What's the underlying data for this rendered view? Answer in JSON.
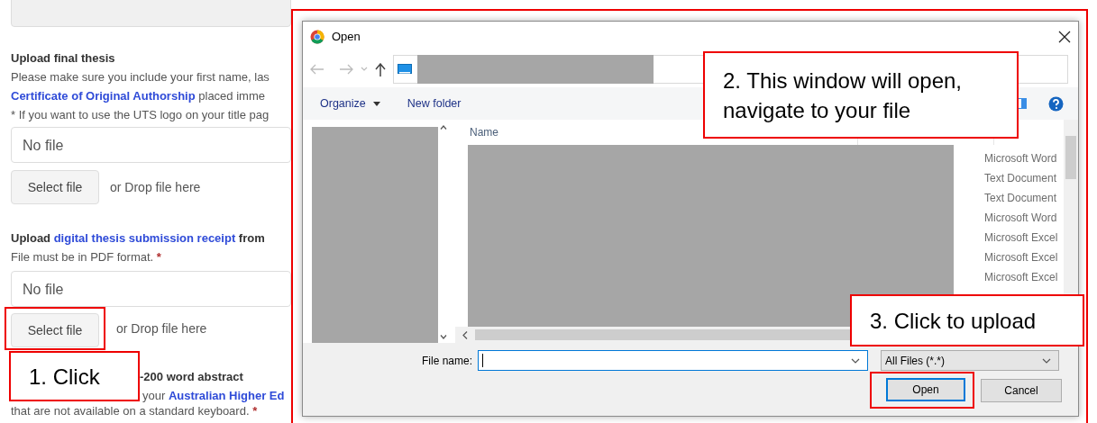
{
  "page": {
    "sections": [
      {
        "kind": "upload",
        "heading": [
          {
            "kind": "bold",
            "text": "Upload final thesis"
          }
        ],
        "lines": [
          [
            {
              "kind": "plain",
              "text": "Please make sure you include your first name, las"
            }
          ],
          [
            {
              "kind": "link",
              "text": "Certificate of Original Authorship"
            },
            {
              "kind": "plain",
              "text": " placed imme"
            }
          ],
          [
            {
              "kind": "plain",
              "text": "* If you want to use the UTS logo on your title pag"
            }
          ]
        ],
        "field": {
          "placeholder": "No file"
        },
        "button": {
          "label": "Select file",
          "highlighted": false
        },
        "drop_hint": "or Drop file here"
      },
      {
        "kind": "upload",
        "heading": [
          {
            "kind": "bold",
            "text": "Upload "
          },
          {
            "kind": "link",
            "text": "digital thesis submission receipt"
          },
          {
            "kind": "bold",
            "text": " from"
          }
        ],
        "lines": [
          [
            {
              "kind": "plain",
              "text": "File must be in PDF format. "
            },
            {
              "kind": "required",
              "text": "*"
            }
          ]
        ],
        "field": {
          "placeholder": "No file"
        },
        "button": {
          "label": "Select file",
          "highlighted": true
        },
        "drop_hint": "or Drop file here"
      },
      {
        "kind": "covered",
        "heading": [
          {
            "kind": "bold",
            "text": "-200 word abstract"
          }
        ],
        "lines": [
          [
            {
              "kind": "plain",
              "text": "your "
            },
            {
              "kind": "link",
              "text": "Australian Higher Ed"
            }
          ],
          [
            {
              "kind": "plain",
              "text": "that are not available on a standard keyboard. "
            },
            {
              "kind": "required",
              "text": "*"
            }
          ]
        ]
      }
    ]
  },
  "dialog": {
    "title": "Open",
    "highlighted": true,
    "toolbar": [
      {
        "label": "Organize",
        "kind": "menu"
      },
      {
        "label": "New folder",
        "kind": "action"
      }
    ],
    "column_header": "Name",
    "file_types": [
      "Microsoft Word",
      "Text Document",
      "Text Document",
      "Microsoft Word",
      "Microsoft Excel",
      "Microsoft Excel",
      "Microsoft Excel"
    ],
    "file_name": {
      "label": "File name:",
      "focused": true
    },
    "filter": "All Files (*.*)",
    "buttons": [
      {
        "label": "Open",
        "default": true,
        "highlighted": true
      },
      {
        "label": "Cancel",
        "default": false,
        "highlighted": false
      }
    ]
  },
  "annotations": [
    {
      "text": "1. Click"
    },
    {
      "text": "2. This window will open, navigate to your file"
    },
    {
      "text": "3. Click to upload"
    }
  ]
}
